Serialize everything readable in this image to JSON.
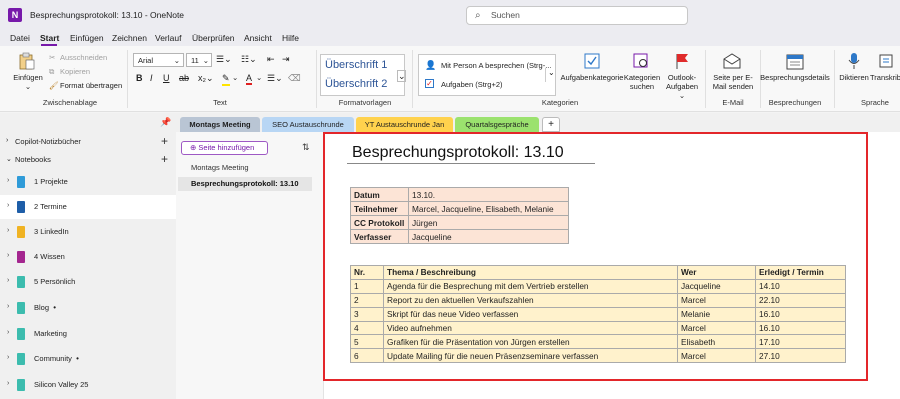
{
  "window": {
    "title": "Besprechungsprotokoll: 13.10  -  OneNote",
    "app_letter": "N"
  },
  "search": {
    "placeholder": "Suchen"
  },
  "menu": [
    "Datei",
    "Start",
    "Einfügen",
    "Zeichnen",
    "Verlauf",
    "Überprüfen",
    "Ansicht",
    "Hilfe"
  ],
  "ribbon": {
    "clipboard": {
      "paste": "Einfügen",
      "cut": "Ausschneiden",
      "copy": "Kopieren",
      "format": "Format übertragen",
      "label": "Zwischenablage"
    },
    "text": {
      "font": "Arial",
      "size": "11",
      "label": "Text"
    },
    "styles": {
      "h1": "Überschrift 1",
      "h2": "Überschrift 2",
      "label": "Formatvorlagen"
    },
    "tags": {
      "tag1": "Mit Person A besprechen (Strg-...",
      "tag2": "Aufgaben (Strg+2)",
      "label": "Kategorien"
    },
    "cat_buttons": {
      "aufgaben": "Aufgabenkategorie",
      "suchen1": "Kategorien",
      "suchen2": "suchen",
      "outlook1": "Outlook-",
      "outlook2": "Aufgaben ⌄"
    },
    "email": {
      "btn1": "Seite per E-",
      "btn2": "Mail senden",
      "label": "E-Mail"
    },
    "meetings": {
      "btn": "Besprechungsdetails",
      "label": "Besprechungen"
    },
    "speech": {
      "dictate": "Diktieren",
      "transcribe": "Transkrib",
      "label": "Sprache"
    }
  },
  "sidebar": {
    "copilot": "Copilot-Notizbücher",
    "notebooks_header": "Notebooks",
    "notebooks": [
      {
        "label": "1 Projekte",
        "color": "#2f9bd8",
        "dot": ""
      },
      {
        "label": "2 Termine",
        "color": "#1e5ea8",
        "dot": ""
      },
      {
        "label": "3 LinkedIn",
        "color": "#f0b323",
        "dot": ""
      },
      {
        "label": "4 Wissen",
        "color": "#a4268f",
        "dot": ""
      },
      {
        "label": "5 Persönlich",
        "color": "#3cbcae",
        "dot": ""
      },
      {
        "label": "Blog",
        "color": "#3cbcae",
        "dot": "•"
      },
      {
        "label": "Marketing",
        "color": "#3cbcae",
        "dot": ""
      },
      {
        "label": "Community",
        "color": "#3cbcae",
        "dot": "•"
      },
      {
        "label": "Silicon Valley 25",
        "color": "#3cbcae",
        "dot": ""
      }
    ]
  },
  "section_tabs": [
    {
      "label": "Montags Meeting",
      "color": "#b9c5d4"
    },
    {
      "label": "SEO Austauschrunde",
      "color": "#b8d6f4"
    },
    {
      "label": "YT Austauschrunde Jan",
      "color": "#ffd24d"
    },
    {
      "label": "Quartalsgespräche",
      "color": "#9be26e"
    },
    {
      "label": "+",
      "color": "#ffffff"
    }
  ],
  "pages": {
    "add_page": "Seite hinzufügen",
    "items": [
      "Montags Meeting",
      "Besprechungsprotokoll: 13.10"
    ]
  },
  "note": {
    "title": "Besprechungsprotokoll: 13.10",
    "info": [
      {
        "key": "Datum",
        "value": "13.10."
      },
      {
        "key": "Teilnehmer",
        "value": "Marcel, Jacqueline,  Elisabeth, Melanie"
      },
      {
        "key": "CC Protokoll",
        "value": "Jürgen"
      },
      {
        "key": "Verfasser",
        "value": "Jacqueline"
      }
    ],
    "task_headers": [
      "Nr.",
      "Thema / Beschreibung",
      "Wer",
      "Erledigt / Termin"
    ],
    "tasks": [
      [
        "1",
        "Agenda für die Besprechung mit dem Vertrieb erstellen",
        "Jacqueline",
        "14.10"
      ],
      [
        "2",
        "Report zu den aktuellen Verkaufszahlen",
        "Marcel",
        "22.10"
      ],
      [
        "3",
        "Skript für das neue Video verfassen",
        "Melanie",
        "16.10"
      ],
      [
        "4",
        "Video aufnehmen",
        "Marcel",
        "16.10"
      ],
      [
        "5",
        "Grafiken für die Präsentation von Jürgen erstellen",
        "Elisabeth",
        "17.10"
      ],
      [
        "6",
        "Update Mailing für die neuen Präsenzseminare verfassen",
        "Marcel",
        "27.10"
      ]
    ]
  }
}
